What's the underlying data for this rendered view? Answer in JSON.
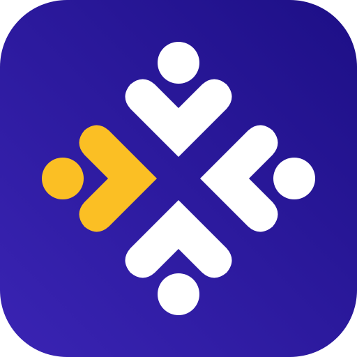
{
  "icon": {
    "name": "four-people-cross-logo",
    "background_gradient": [
      "#3a24b4",
      "#1d0f86"
    ],
    "primary_color": "#ffffff",
    "accent_color": "#fbbf24",
    "figures": [
      {
        "direction": "top",
        "color": "#ffffff"
      },
      {
        "direction": "right",
        "color": "#ffffff"
      },
      {
        "direction": "bottom",
        "color": "#ffffff"
      },
      {
        "direction": "left",
        "color": "#fbbf24"
      }
    ]
  }
}
